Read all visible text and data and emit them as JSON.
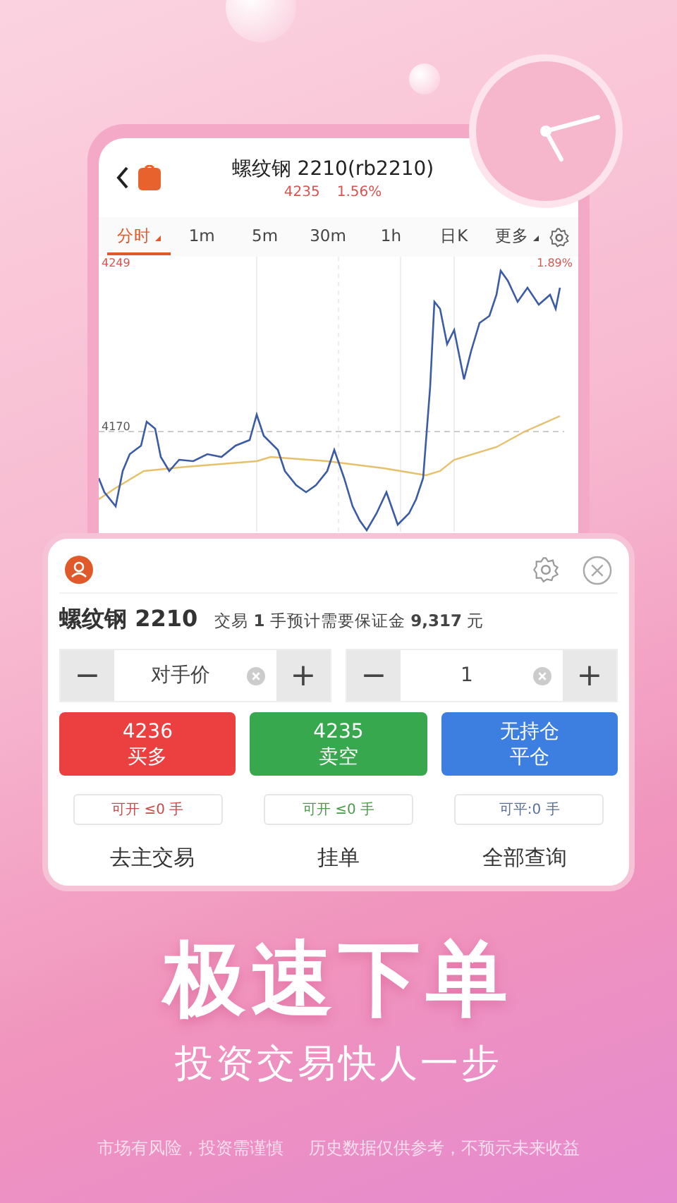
{
  "phone_screen": {
    "title": "螺纹钢 2210(rb2210)",
    "price": "4235",
    "change": "1.56%",
    "tabs": [
      {
        "label": "分时",
        "selected": true,
        "dropdown": true
      },
      {
        "label": "1m",
        "selected": false,
        "dropdown": false
      },
      {
        "label": "5m",
        "selected": false,
        "dropdown": false
      },
      {
        "label": "30m",
        "selected": false,
        "dropdown": false
      },
      {
        "label": "1h",
        "selected": false,
        "dropdown": false
      },
      {
        "label": "日K",
        "selected": false,
        "dropdown": false
      },
      {
        "label": "更多",
        "selected": false,
        "dropdown": true
      }
    ],
    "chart": {
      "high_label": "4249",
      "mid_label": "4170",
      "pct_label": "1.89%"
    }
  },
  "order_card": {
    "contract": "螺纹钢 2210",
    "margin_note": "交易 **1** 手预计需要保证金 **9,317** 元",
    "steppers": [
      {
        "minus": "−",
        "value": "对手价",
        "plus": "+"
      },
      {
        "minus": "−",
        "value": "1",
        "plus": "+"
      }
    ],
    "actions": [
      {
        "kind": "buy",
        "price": "4236",
        "label": "买多",
        "available": "可开 ≤0 手"
      },
      {
        "kind": "sell",
        "price": "4235",
        "label": "卖空",
        "available": "可开 ≤0 手"
      },
      {
        "kind": "close",
        "price": "无持仓",
        "label": "平仓",
        "available": "可平:0 手"
      }
    ],
    "links": [
      "去主交易",
      "挂单",
      "全部查询"
    ]
  },
  "headline": "极速下单",
  "subheadline": "投资交易快人一步",
  "disclaimers": [
    "市场有风险，投资需谨慎",
    "历史数据仅供参考，不预示未来收益"
  ]
}
